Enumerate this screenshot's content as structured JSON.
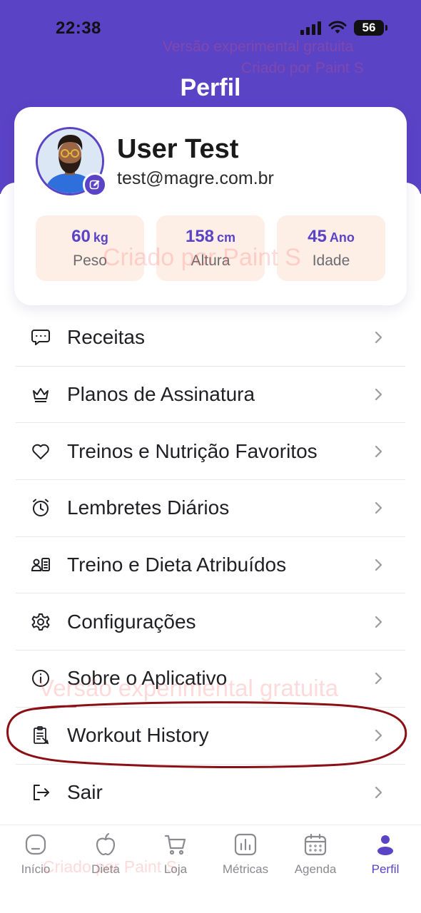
{
  "status_bar": {
    "time": "22:38",
    "battery": "56"
  },
  "watermarks": {
    "top_line1": "Versão experimental gratuita",
    "top_line2": "Criado por Paint S",
    "card": "Criado por Paint S",
    "menu": "Versão experimental gratuita",
    "tabbar": "Criado por Paint S"
  },
  "header": {
    "title": "Perfil"
  },
  "profile": {
    "name": "User Test",
    "email": "test@magre.com.br",
    "stats": [
      {
        "value": "60",
        "unit": "kg",
        "label": "Peso"
      },
      {
        "value": "158",
        "unit": "cm",
        "label": "Altura"
      },
      {
        "value": "45",
        "unit": "Ano",
        "label": "Idade"
      }
    ]
  },
  "menu": {
    "items": [
      {
        "label": "Receitas",
        "icon": "chat-bubble-icon"
      },
      {
        "label": "Planos de Assinatura",
        "icon": "crown-icon"
      },
      {
        "label": "Treinos e Nutrição Favoritos",
        "icon": "heart-icon"
      },
      {
        "label": "Lembretes Diários",
        "icon": "alarm-clock-icon"
      },
      {
        "label": "Treino e Dieta Atribuídos",
        "icon": "assigned-user-icon"
      },
      {
        "label": "Configurações",
        "icon": "gear-icon"
      },
      {
        "label": "Sobre o Aplicativo",
        "icon": "info-icon"
      },
      {
        "label": "Workout History",
        "icon": "clipboard-history-icon"
      },
      {
        "label": "Sair",
        "icon": "logout-icon"
      }
    ]
  },
  "tabbar": {
    "tabs": [
      {
        "label": "Início",
        "icon": "home-icon"
      },
      {
        "label": "Dieta",
        "icon": "apple-icon"
      },
      {
        "label": "Loja",
        "icon": "cart-icon"
      },
      {
        "label": "Métricas",
        "icon": "bar-chart-icon"
      },
      {
        "label": "Agenda",
        "icon": "calendar-icon"
      },
      {
        "label": "Perfil",
        "icon": "person-icon"
      }
    ],
    "active": "Perfil"
  },
  "colors": {
    "accent": "#5b43c6",
    "stat_bg": "#fdeee6",
    "annotation": "#8b0f14"
  }
}
